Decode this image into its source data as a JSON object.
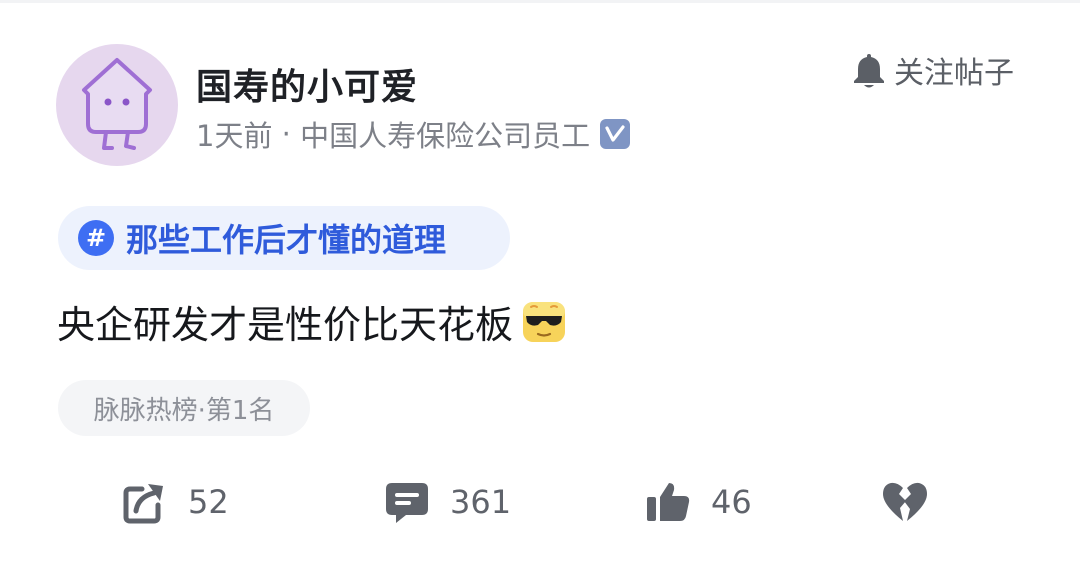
{
  "user": {
    "name": "国寿的小可爱",
    "time": "1天前",
    "separator": " · ",
    "affiliation": "中国人寿保险公司员工"
  },
  "follow": {
    "label": "关注帖子",
    "icon": "bell-icon"
  },
  "topic": {
    "hash": "#",
    "label": "那些工作后才懂的道理"
  },
  "post": {
    "text": "央企研发才是性价比天花板",
    "emoji": "sunglasses-emoji"
  },
  "hot_badge": {
    "label": "脉脉热榜·第1名"
  },
  "actions": {
    "share": {
      "icon": "share-icon",
      "count": "52"
    },
    "comment": {
      "icon": "comment-icon",
      "count": "361"
    },
    "like": {
      "icon": "thumbs-up-icon",
      "count": "46"
    },
    "dislike": {
      "icon": "broken-heart-icon"
    }
  },
  "colors": {
    "accent": "#3e6ef3",
    "topic_bg": "#edf2fd",
    "avatar_bg": "#e6d7ee",
    "icon_gray": "#5f636b"
  }
}
